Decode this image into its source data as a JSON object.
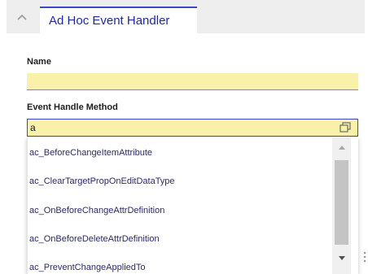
{
  "header": {
    "collapse_icon": "chevron-up-icon",
    "tab_title": "Ad Hoc Event Handler"
  },
  "form": {
    "name_label": "Name",
    "name_value": "",
    "method_label": "Event Handle Method",
    "method_value": "a",
    "lookup_icon": "lookup-copy-icon"
  },
  "dropdown": {
    "items": [
      "ac_BeforeChangeItemAttribute",
      "ac_ClearTargetPropOnEditDataType",
      "ac_OnBeforeChangeAttrDefinition",
      "ac_OnBeforeDeleteAttrDefinition",
      "ac_PreventChangeAppliedTo"
    ]
  },
  "colors": {
    "accent": "#3d48c8",
    "tab_text": "#1c2aa8",
    "field_background": "#f9f1a9",
    "tabstrip_background": "#eeeeee"
  }
}
